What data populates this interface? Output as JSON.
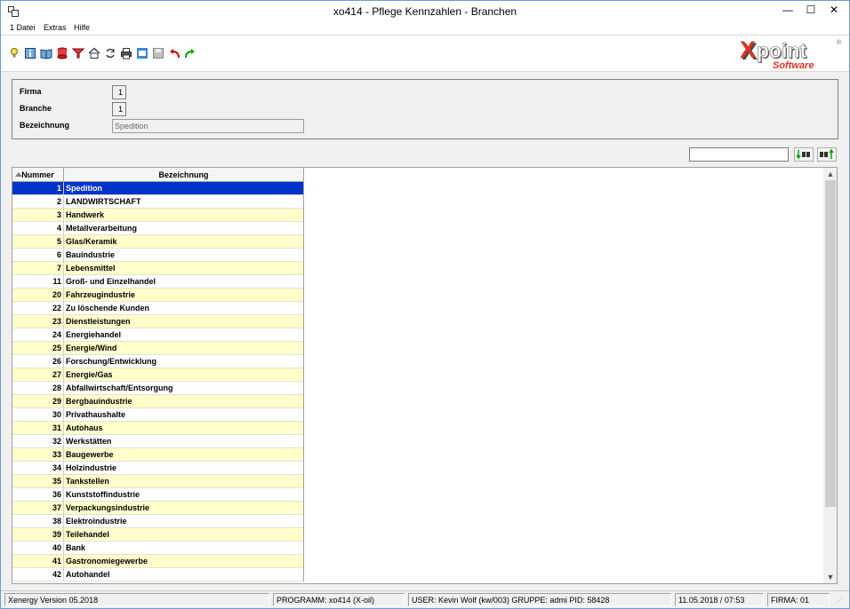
{
  "window": {
    "title": "xo414 - Pflege Kennzahlen - Branchen",
    "minimize": "—",
    "maximize": "☐",
    "close": "✕"
  },
  "menu": {
    "items": [
      {
        "label": "1 Datei"
      },
      {
        "label": "Extras"
      },
      {
        "label": "Hilfe"
      }
    ]
  },
  "toolbar": {
    "icons": [
      "lightbulb-icon",
      "info-book-icon",
      "open-book-icon",
      "database-icon",
      "filter-icon",
      "home-icon",
      "refresh-icon",
      "print-icon",
      "window-icon",
      "save-icon",
      "undo-icon",
      "redo-icon"
    ],
    "colors": {
      "undo": "#cc0000",
      "redo": "#00a000"
    }
  },
  "logo": {
    "brand": "Xpoint",
    "sub": "Software",
    "colors": {
      "x": "#e03020",
      "text": "#ffffff",
      "shadow": "#4a4a4a"
    }
  },
  "header": {
    "firma_label": "Firma",
    "firma_value": "1",
    "branche_label": "Branche",
    "branche_value": "1",
    "bezeichnung_label": "Bezeichnung",
    "bezeichnung_value": "Spedition"
  },
  "search": {
    "value": ""
  },
  "grid": {
    "columns": {
      "nummer": "Nummer",
      "bezeichnung": "Bezeichnung"
    },
    "selected_index": 0,
    "rows": [
      {
        "nummer": "1",
        "bezeichnung": "Spedition"
      },
      {
        "nummer": "2",
        "bezeichnung": "LANDWIRTSCHAFT"
      },
      {
        "nummer": "3",
        "bezeichnung": "Handwerk"
      },
      {
        "nummer": "4",
        "bezeichnung": "Metallverarbeitung"
      },
      {
        "nummer": "5",
        "bezeichnung": "Glas/Keramik"
      },
      {
        "nummer": "6",
        "bezeichnung": "Bauindustrie"
      },
      {
        "nummer": "7",
        "bezeichnung": "Lebensmittel"
      },
      {
        "nummer": "11",
        "bezeichnung": "Groß- und Einzelhandel"
      },
      {
        "nummer": "20",
        "bezeichnung": "Fahrzeugindustrie"
      },
      {
        "nummer": "22",
        "bezeichnung": "Zu löschende Kunden"
      },
      {
        "nummer": "23",
        "bezeichnung": "Dienstleistungen"
      },
      {
        "nummer": "24",
        "bezeichnung": "Energiehandel"
      },
      {
        "nummer": "25",
        "bezeichnung": "Energie/Wind"
      },
      {
        "nummer": "26",
        "bezeichnung": "Forschung/Entwicklung"
      },
      {
        "nummer": "27",
        "bezeichnung": "Energie/Gas"
      },
      {
        "nummer": "28",
        "bezeichnung": "Abfallwirtschaft/Entsorgung"
      },
      {
        "nummer": "29",
        "bezeichnung": "Bergbauindustrie"
      },
      {
        "nummer": "30",
        "bezeichnung": "Privathaushalte"
      },
      {
        "nummer": "31",
        "bezeichnung": "Autohaus"
      },
      {
        "nummer": "32",
        "bezeichnung": "Werkstätten"
      },
      {
        "nummer": "33",
        "bezeichnung": "Baugewerbe"
      },
      {
        "nummer": "34",
        "bezeichnung": "Holzindustrie"
      },
      {
        "nummer": "35",
        "bezeichnung": "Tankstellen"
      },
      {
        "nummer": "36",
        "bezeichnung": "Kunststoffindustrie"
      },
      {
        "nummer": "37",
        "bezeichnung": "Verpackungsindustrie"
      },
      {
        "nummer": "38",
        "bezeichnung": "Elektroindustrie"
      },
      {
        "nummer": "39",
        "bezeichnung": "Teilehandel"
      },
      {
        "nummer": "40",
        "bezeichnung": "Bank"
      },
      {
        "nummer": "41",
        "bezeichnung": "Gastronomiegewerbe"
      },
      {
        "nummer": "42",
        "bezeichnung": "Autohandel"
      }
    ]
  },
  "status": {
    "version": "Xenergy Version 05.2018",
    "programm": "PROGRAMM: xo414 (X-oil)",
    "user": "USER: Kevin Wolf (kw/003)  GRUPPE: admi  PID: 58428",
    "datetime": "11.05.2018 / 07:53",
    "firma": "FIRMA: 01"
  }
}
